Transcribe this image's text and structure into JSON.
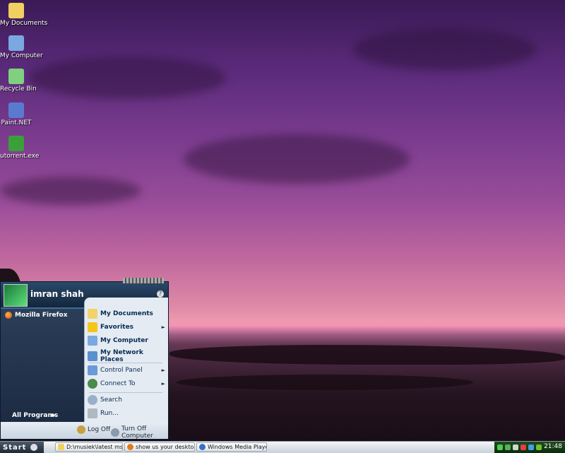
{
  "desktop": {
    "icons": [
      {
        "label": "My Documents",
        "icon": "folder-icon",
        "color": "#f0d060"
      },
      {
        "label": "My Computer",
        "icon": "computer-icon",
        "color": "#7aa8e0"
      },
      {
        "label": "Recycle Bin",
        "icon": "recycle-bin-icon",
        "color": "#7fd07f"
      },
      {
        "label": "Paint.NET",
        "icon": "paint-net-icon",
        "color": "#5a7ad0"
      },
      {
        "label": "utorrent.exe",
        "icon": "utorrent-icon",
        "color": "#3aa03a"
      }
    ]
  },
  "start_menu": {
    "username": "imran shah",
    "pinned": [
      {
        "label": "Mozilla Firefox",
        "icon": "firefox-icon"
      }
    ],
    "all_programs_label": "All Programs",
    "right_items": [
      {
        "label": "My Documents",
        "icon": "folder-icon",
        "bold": true,
        "color": "#f2d36a"
      },
      {
        "label": "Favorites",
        "icon": "star-icon",
        "bold": true,
        "color": "#f5c518",
        "arrow": true
      },
      {
        "label": "My Computer",
        "icon": "computer-icon",
        "bold": true,
        "color": "#7aa8e0"
      },
      {
        "label": "My Network Places",
        "icon": "network-icon",
        "bold": true,
        "color": "#5a90d0"
      },
      {
        "label": "Control Panel",
        "icon": "control-panel-icon",
        "bold": false,
        "color": "#6a9ad8",
        "arrow": true
      },
      {
        "label": "Connect To",
        "icon": "globe-icon",
        "bold": false,
        "color": "#4a8a4a",
        "arrow": true
      },
      {
        "label": "Search",
        "icon": "search-icon",
        "bold": false,
        "color": "#9ab0c8"
      },
      {
        "label": "Run...",
        "icon": "run-icon",
        "bold": false,
        "color": "#b0b8c0"
      }
    ],
    "log_off_label": "Log Off",
    "turn_off_label": "Turn Off Computer"
  },
  "taskbar": {
    "start_label": "Start",
    "buttons": [
      {
        "label": "D:\\musiek\\latest msk",
        "icon": "folder-icon",
        "color": "#f0d060"
      },
      {
        "label": "show us your desktop......",
        "icon": "firefox-icon",
        "color": "#e07a20"
      },
      {
        "label": "Windows Media Player",
        "icon": "media-player-icon",
        "color": "#3a70c0"
      }
    ],
    "tray_icons": [
      "green-app-icon",
      "network-status-icon",
      "volume-icon",
      "antivirus-icon",
      "messenger-icon",
      "nvidia-icon"
    ],
    "clock": "21:48"
  }
}
